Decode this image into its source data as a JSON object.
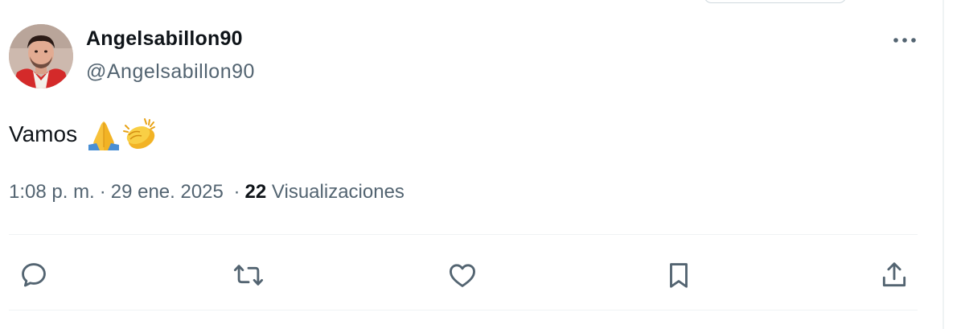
{
  "author": {
    "display_name": "Angelsabillon90",
    "handle": "@Angelsabillon90",
    "avatar_icon": "profile-photo"
  },
  "post": {
    "text": "Vamos",
    "emojis": [
      "folded-hands-emoji",
      "clapping-hands-emoji"
    ]
  },
  "meta": {
    "time": "1:08 p. m.",
    "date": "29 ene. 2025",
    "separator": "·",
    "views_count": "22",
    "views_label": "Visualizaciones"
  },
  "actions": [
    {
      "name": "reply-icon"
    },
    {
      "name": "repost-icon"
    },
    {
      "name": "like-icon"
    },
    {
      "name": "bookmark-icon"
    },
    {
      "name": "share-icon"
    }
  ],
  "colors": {
    "text_primary": "#0f1419",
    "text_secondary": "#536471",
    "divider": "#eff3f4"
  }
}
